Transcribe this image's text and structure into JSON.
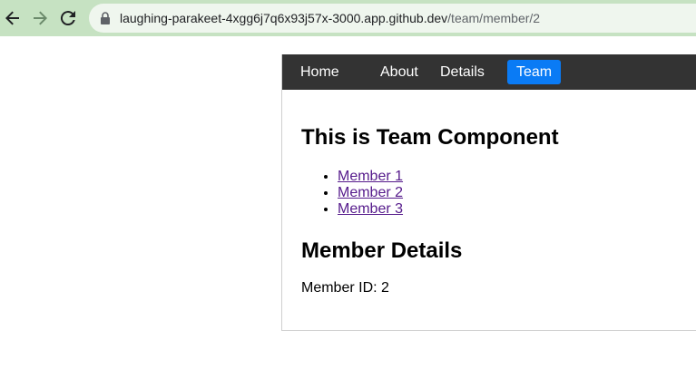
{
  "browser": {
    "url_host": "laughing-parakeet-4xgg6j7q6x93j57x-3000.app.github.dev",
    "url_path": "/team/member/2"
  },
  "nav": {
    "items": [
      {
        "label": "Home"
      },
      {
        "label": "About"
      },
      {
        "label": "Details"
      },
      {
        "label": "Team"
      }
    ],
    "active_color": "#0a7bf5",
    "bar_color": "#333333"
  },
  "team": {
    "title": "This is Team Component",
    "members": [
      {
        "label": "Member 1"
      },
      {
        "label": "Member 2"
      },
      {
        "label": "Member 3"
      }
    ]
  },
  "details": {
    "title": "Member Details",
    "member_id_text": "Member ID: 2"
  }
}
